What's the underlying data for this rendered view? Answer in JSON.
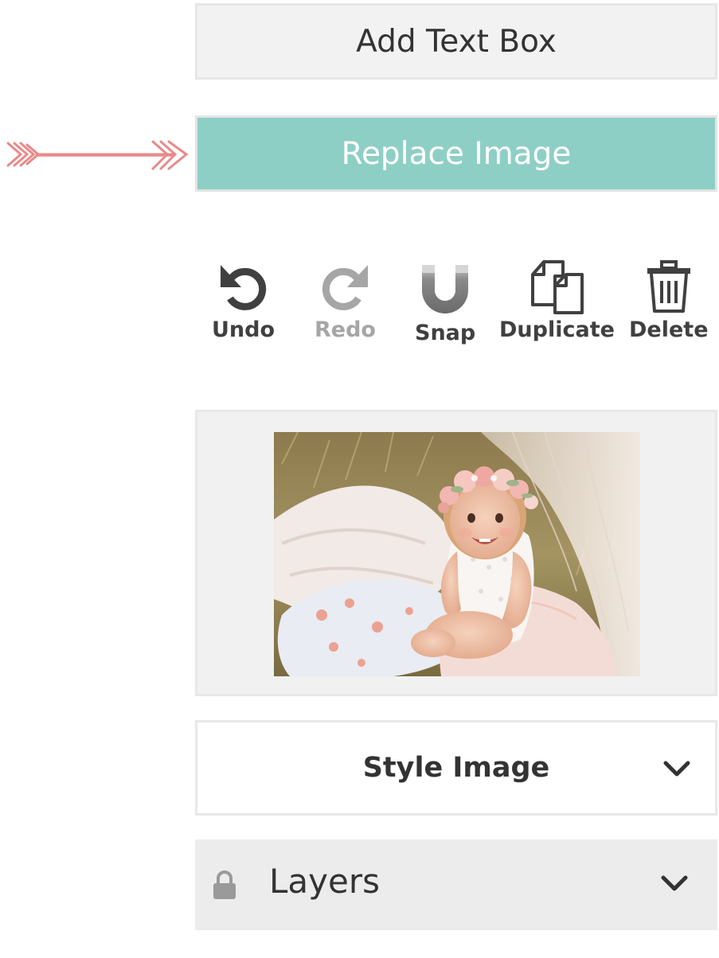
{
  "toolbar": {
    "add_text_box_label": "Add Text Box",
    "replace_image_label": "Replace Image",
    "accent_color": "#8ecfc5",
    "arrow_color": "#e88a8a"
  },
  "tools": {
    "undo": {
      "label": "Undo",
      "icon": "undo-icon",
      "enabled": true
    },
    "redo": {
      "label": "Redo",
      "icon": "redo-icon",
      "enabled": false
    },
    "snap": {
      "label": "Snap",
      "icon": "magnet-icon",
      "enabled": true
    },
    "duplicate": {
      "label": "Duplicate",
      "icon": "duplicate-icon",
      "enabled": true
    },
    "delete": {
      "label": "Delete",
      "icon": "trash-icon",
      "enabled": true
    }
  },
  "image_preview": {
    "subject": "photo-thumbnail"
  },
  "sections": {
    "style_image": {
      "label": "Style Image",
      "icon": "chevron-down-icon"
    },
    "layers": {
      "label": "Layers",
      "lock_icon": "lock-icon",
      "icon": "chevron-down-icon"
    }
  }
}
